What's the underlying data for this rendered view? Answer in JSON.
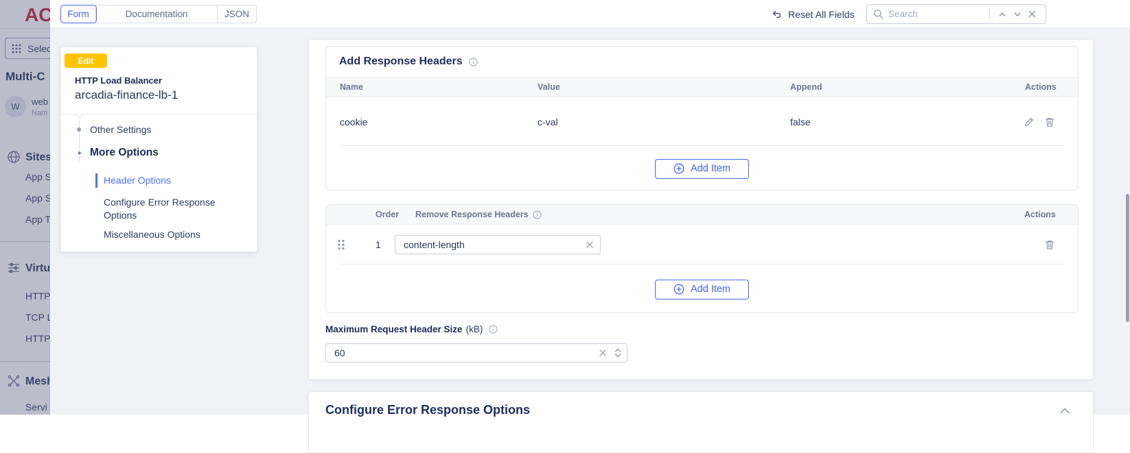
{
  "colors": {
    "accent_blue": "#4161f1",
    "link_blue": "#4c6ef5",
    "badge_yellow": "#ffc400",
    "logo_red": "#c11236",
    "navy_text": "#1c2a58",
    "table_header_bg": "#f7f8fa",
    "page_bg": "#f1f2f6"
  },
  "background": {
    "logo": "AC",
    "select_button": "Selec",
    "heading": "Multi-C",
    "avatar_initial": "W",
    "avatar_line1": "web",
    "avatar_line2": "Nam",
    "sections": [
      {
        "icon": "globe",
        "title": "Sites",
        "items": [
          "App S",
          "App S",
          "App T"
        ]
      },
      {
        "icon": "sliders",
        "title": "Virtu",
        "items": [
          "HTTP",
          "TCP L",
          "HTTP"
        ]
      },
      {
        "icon": "mesh",
        "title": "Mesh",
        "items": [
          "Servi"
        ]
      }
    ]
  },
  "topbar": {
    "tabs": [
      {
        "label": "Form"
      },
      {
        "label": "Documentation"
      },
      {
        "label": "JSON"
      }
    ],
    "reset_label": "Reset All Fields",
    "search_placeholder": "Search"
  },
  "sidebar": {
    "badge": "Edit",
    "type_label": "HTTP Load Balancer",
    "object_name": "arcadia-finance-lb-1",
    "tree": [
      {
        "label": "Other Settings"
      },
      {
        "label": "More Options"
      },
      {
        "label": "Header Options",
        "active": true
      },
      {
        "label": "Configure Error Response Options"
      },
      {
        "label": "Miscellaneous Options"
      }
    ]
  },
  "main": {
    "add_table": {
      "title": "Add Response Headers",
      "columns": [
        "Name",
        "Value",
        "Append",
        "Actions"
      ],
      "rows": [
        {
          "name": "cookie",
          "value": "c-val",
          "append": "false"
        }
      ],
      "add_item_label": "Add Item"
    },
    "remove_table": {
      "columns": [
        "Order",
        "Remove Response Headers",
        "Actions"
      ],
      "rows": [
        {
          "order": "1",
          "value": "content-length"
        }
      ],
      "add_item_label": "Add Item"
    },
    "max_header_size": {
      "label": "Maximum Request Header Size",
      "unit": "(kB)",
      "value": "60"
    }
  },
  "bottom_section": {
    "title": "Configure Error Response Options"
  }
}
